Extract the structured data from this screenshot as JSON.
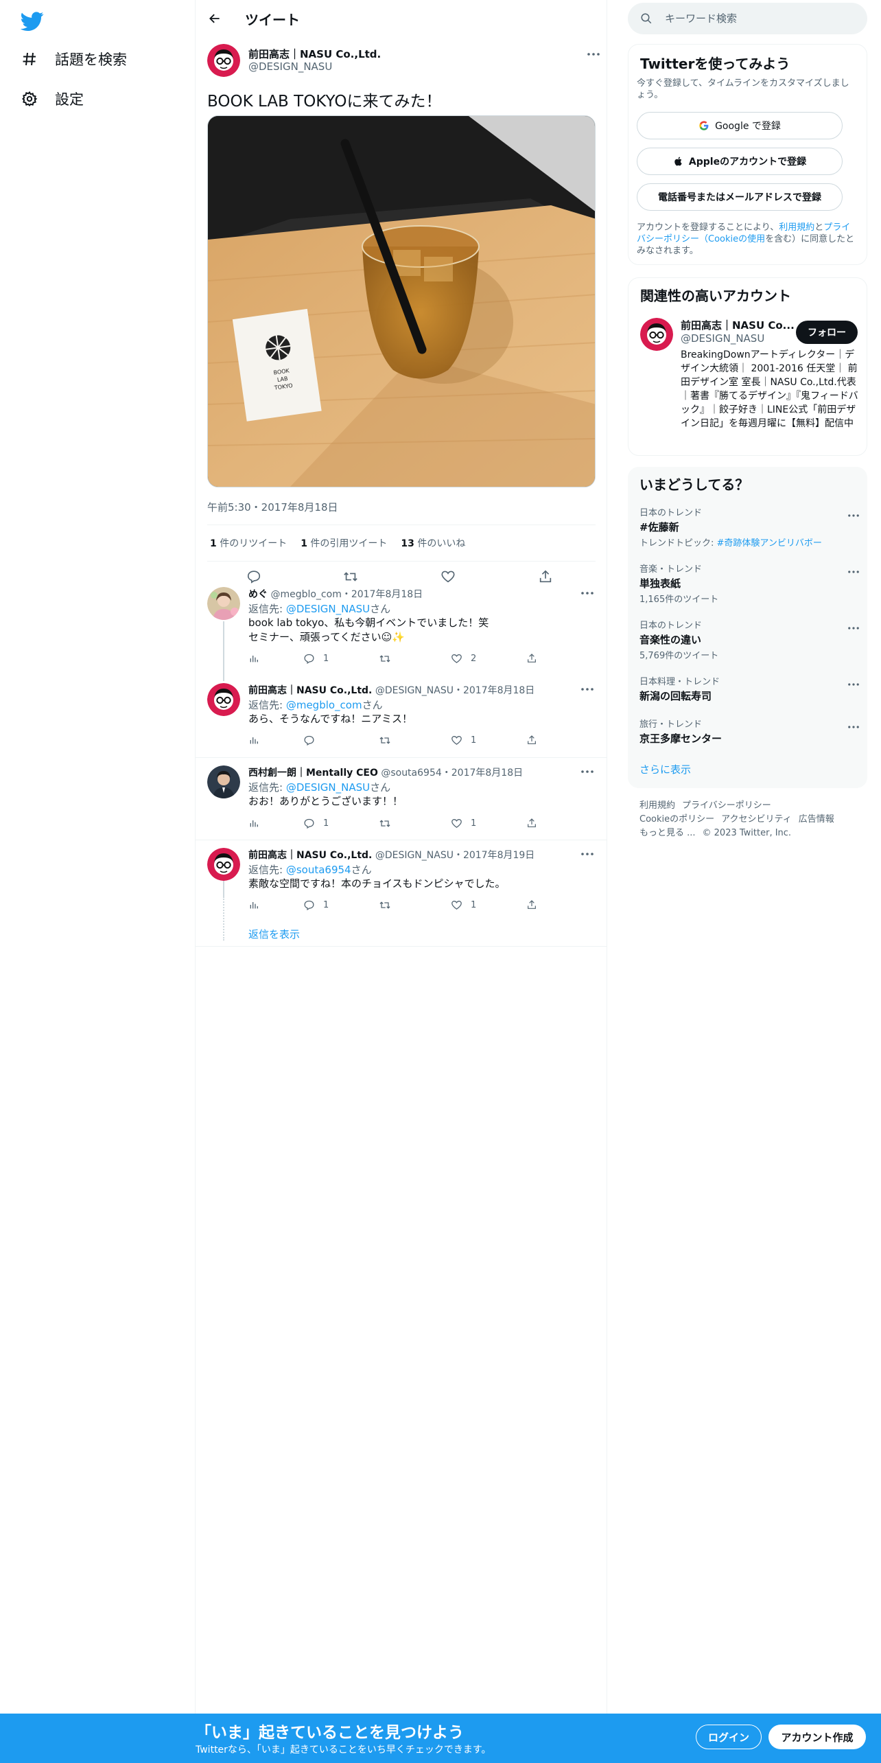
{
  "colors": {
    "accent": "#1d9bf0",
    "text": "#0f1419",
    "muted": "#536471",
    "border": "#eff3f4"
  },
  "sidebar": {
    "logo_icon": "twitter-bird-icon",
    "items": [
      {
        "label": "話題を検索",
        "icon": "hashtag-icon"
      },
      {
        "label": "設定",
        "icon": "gear-icon"
      }
    ]
  },
  "header": {
    "title": "ツイート",
    "back_icon": "arrow-left-icon"
  },
  "tweet": {
    "author_name": "前田高志｜NASU Co.,Ltd.",
    "author_handle": "@DESIGN_NASU",
    "text": "BOOK LAB TOKYOに来てみた！",
    "card_text": [
      "BOOK",
      "LAB",
      "TOKYO"
    ],
    "timestamp": "午前5:30・2017年8月18日",
    "stats": {
      "retweets_count": "1",
      "retweets_label": "件のリツイート",
      "quotes_count": "1",
      "quotes_label": "件の引用ツイート",
      "likes_count": "13",
      "likes_label": "件のいいね"
    }
  },
  "replies": [
    {
      "name": "めぐ",
      "meta": "@megblo_com・2017年8月18日",
      "reply_prefix": "返信先: ",
      "mention": "@DESIGN_NASU",
      "reply_suffix": "さん",
      "line1": "book lab tokyo、私も今朝イベントでいました！笑",
      "line2": "セミナー、頑張ってください☺✨",
      "reply_count": "1",
      "retweet_count": "",
      "like_count": "2"
    },
    {
      "name": "前田高志｜NASU Co.,Ltd.",
      "meta": "@DESIGN_NASU・2017年8月18日",
      "reply_prefix": "返信先: ",
      "mention": "@megblo_com",
      "reply_suffix": "さん",
      "line1": "あら、そうなんですね！ニアミス！",
      "line2": "",
      "reply_count": "",
      "retweet_count": "",
      "like_count": "1"
    },
    {
      "name": "西村創一朗｜Mentally CEO",
      "meta": "@souta6954・2017年8月18日",
      "reply_prefix": "返信先: ",
      "mention": "@DESIGN_NASU",
      "reply_suffix": "さん",
      "line1": "おお！ありがとうございます！！",
      "line2": "",
      "reply_count": "1",
      "retweet_count": "",
      "like_count": "1"
    },
    {
      "name": "前田高志｜NASU Co.,Ltd.",
      "meta": "@DESIGN_NASU・2017年8月19日",
      "reply_prefix": "返信先: ",
      "mention": "@souta6954",
      "reply_suffix": "さん",
      "line1": "素敵な空間ですね！本のチョイスもドンピシャでした。",
      "line2": "",
      "reply_count": "1",
      "retweet_count": "",
      "like_count": "1"
    }
  ],
  "show_replies": "返信を表示",
  "search": {
    "placeholder": "キーワード検索"
  },
  "signup_card": {
    "title": "Twitterを使ってみよう",
    "subtitle": "今すぐ登録して、タイムラインをカスタマイズしましょう。",
    "google": "Google で登録",
    "apple": "Appleのアカウントで登録",
    "phone": "電話番号またはメールアドレスで登録",
    "legal_1": "アカウントを登録することにより、",
    "legal_terms": "利用規約",
    "legal_2": "と",
    "legal_privacy": "プライバシーポリシー（Cookieの使用",
    "legal_3": "を含む）に同意したとみなされます。"
  },
  "related": {
    "title": "関連性の高いアカウント",
    "name": "前田高志｜NASU Co...",
    "handle": "@DESIGN_NASU",
    "follow": "フォロー",
    "bio": "BreakingDownアートディレクター｜デザイン大統領｜ 2001-2016 任天堂｜ 前田デザイン室 室長｜NASU Co.,Ltd.代表｜著書『勝てるデザイン』『鬼フィードバック』｜餃子好き｜LINE公式「前田デザイン日記」を毎週月曜に【無料】配信中"
  },
  "trends": {
    "title": "いまどうしてる？",
    "items": [
      {
        "category": "日本のトレンド",
        "title": "#佐藤新",
        "sub_prefix": "トレンドトピック: ",
        "sub_link": "#奇跡体験アンビリバボー"
      },
      {
        "category": "音楽・トレンド",
        "title": "単独表紙",
        "sub": "1,165件のツイート"
      },
      {
        "category": "日本のトレンド",
        "title": "音楽性の違い",
        "sub": "5,769件のツイート"
      },
      {
        "category": "日本料理・トレンド",
        "title": "新潟の回転寿司",
        "sub": ""
      },
      {
        "category": "旅行・トレンド",
        "title": "京王多摩センター",
        "sub": ""
      }
    ],
    "show_more": "さらに表示"
  },
  "footer": {
    "links": [
      "利用規約",
      "プライバシーポリシー",
      "Cookieのポリシー",
      "アクセシビリティ",
      "広告情報",
      "もっと見る ..."
    ],
    "copyright": "© 2023 Twitter, Inc."
  },
  "bottom_bar": {
    "title": "「いま」起きていることを見つけよう",
    "subtitle": "Twitterなら、「いま」起きていることをいち早くチェックできます。",
    "login": "ログイン",
    "signup": "アカウント作成"
  }
}
